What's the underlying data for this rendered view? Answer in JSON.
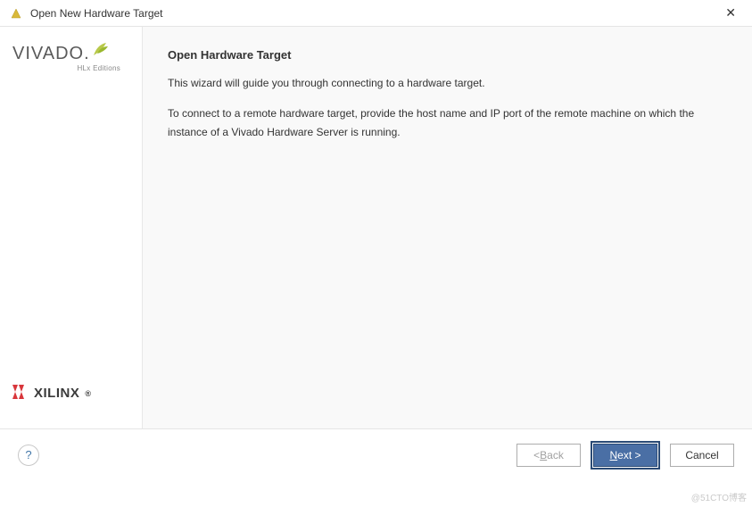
{
  "window": {
    "title": "Open New Hardware Target",
    "close_symbol": "✕"
  },
  "sidebar": {
    "vivado": {
      "brand": "VIVADO",
      "subtitle": "HLx Editions"
    },
    "xilinx": {
      "brand": "XILINX"
    }
  },
  "main": {
    "heading": "Open Hardware Target",
    "intro": "This wizard will guide you through connecting to a hardware target.",
    "detail": "To connect to a remote hardware target, provide the host name and IP port of the remote machine on which the instance of a Vivado Hardware Server is running."
  },
  "footer": {
    "help_label": "?",
    "back_prefix": "< ",
    "back_mnemonic": "B",
    "back_suffix": "ack",
    "next_mnemonic": "N",
    "next_suffix": "ext >",
    "cancel": "Cancel"
  },
  "watermark": "@51CTO博客"
}
